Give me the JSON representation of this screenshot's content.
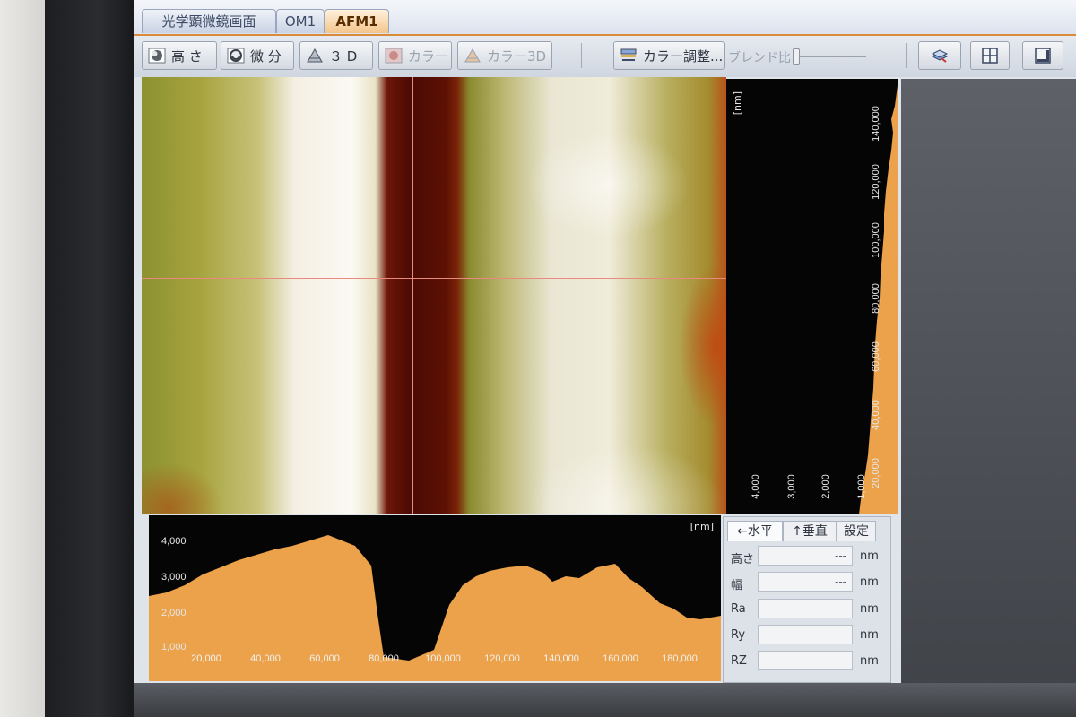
{
  "tabs": [
    {
      "label": "光学顕微鏡画面",
      "active": false
    },
    {
      "label": "OM1",
      "active": false
    },
    {
      "label": "AFM1",
      "active": true
    }
  ],
  "toolbar": {
    "height": "高 さ",
    "derivative": "微 分",
    "three_d": "３ D",
    "color": "カラー",
    "color_3d": "カラー3D",
    "color_adjust": "カラー調整...",
    "blend_ratio": "ブレンド比"
  },
  "vertical_profile": {
    "unit": "[nm]",
    "y_ticks": [
      "140,000",
      "120,000",
      "100,000",
      "80,000",
      "60,000",
      "40,000",
      "20,000"
    ],
    "value_ticks": [
      "4,000",
      "3,000",
      "2,000",
      "1,000"
    ]
  },
  "horizontal_profile": {
    "unit": "[nm]",
    "y_ticks": [
      "4,000",
      "3,000",
      "2,000",
      "1,000"
    ],
    "x_ticks": [
      "20,000",
      "40,000",
      "60,000",
      "80,000",
      "100,000",
      "120,000",
      "140,000",
      "160,000",
      "180,000"
    ]
  },
  "measure_panel": {
    "tabs": [
      "←水平",
      "↑垂直",
      "設定"
    ],
    "rows": [
      {
        "label": "高さ",
        "value": "---",
        "unit": "nm"
      },
      {
        "label": "幅",
        "value": "---",
        "unit": "nm"
      },
      {
        "label": "Ra",
        "value": "---",
        "unit": "nm"
      },
      {
        "label": "Ry",
        "value": "---",
        "unit": "nm"
      },
      {
        "label": "RZ",
        "value": "---",
        "unit": "nm"
      }
    ]
  },
  "colors": {
    "accent": "#d98b3a",
    "profile_fill": "#eca24a",
    "profile_bg": "#050505"
  }
}
